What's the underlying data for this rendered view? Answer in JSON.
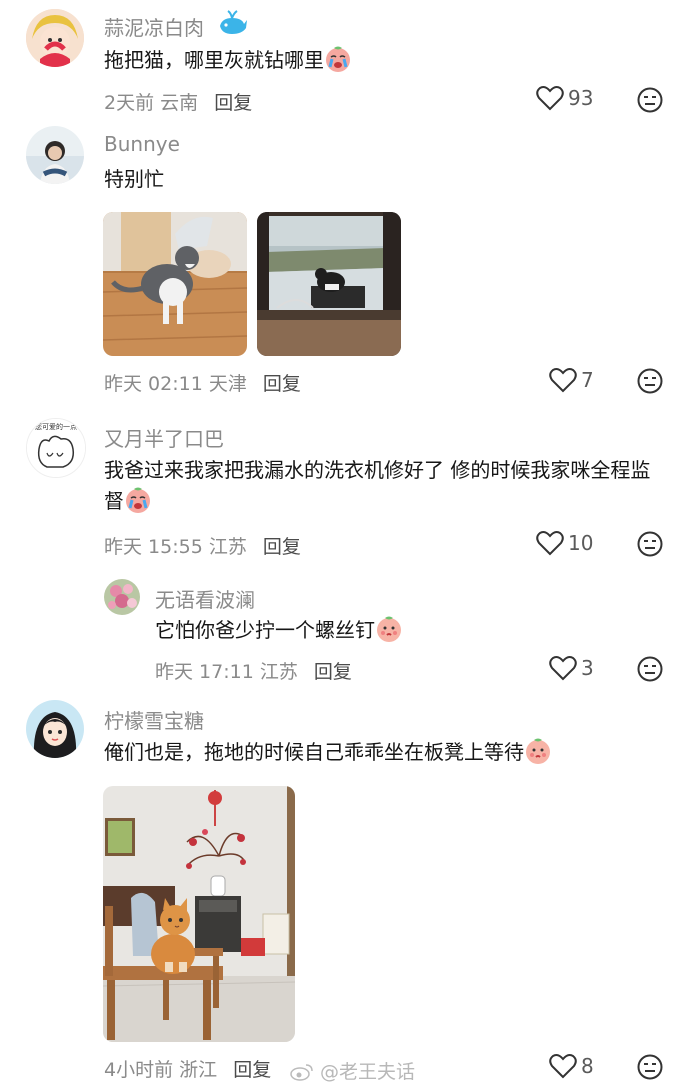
{
  "comments": [
    {
      "username": "蒜泥凉白肉",
      "text": "拖把猫，哪里灰就钻哪里",
      "date": "2天前",
      "location": "云南",
      "reply_label": "回复",
      "likes": "93",
      "icon": "whale-icon"
    },
    {
      "username": "Bunnye",
      "text": "特别忙",
      "date": "昨天 02:11",
      "location": "天津",
      "reply_label": "回复",
      "likes": "7"
    },
    {
      "username": "又月半了口巴",
      "avatar_caption": "您可爱的一点",
      "text": "我爸过来我家把我漏水的洗衣机修好了 修的时候我家咪全程监督",
      "date": "昨天 15:55",
      "location": "江苏",
      "reply_label": "回复",
      "likes": "10"
    },
    {
      "username": "无语看波澜",
      "text": "它怕你爸少拧一个螺丝钉",
      "date": "昨天 17:11",
      "location": "江苏",
      "reply_label": "回复",
      "likes": "3"
    },
    {
      "username": "柠檬雪宝糖",
      "text": "俺们也是，拖地的时候自己乖乖坐在板凳上等待",
      "date": "4小时前",
      "location": "浙江",
      "reply_label": "回复",
      "likes": "8"
    }
  ],
  "watermark": "@老王夫话",
  "colors": {
    "text": "#161616",
    "muted": "#8a8a8a",
    "icon": "#333333"
  }
}
